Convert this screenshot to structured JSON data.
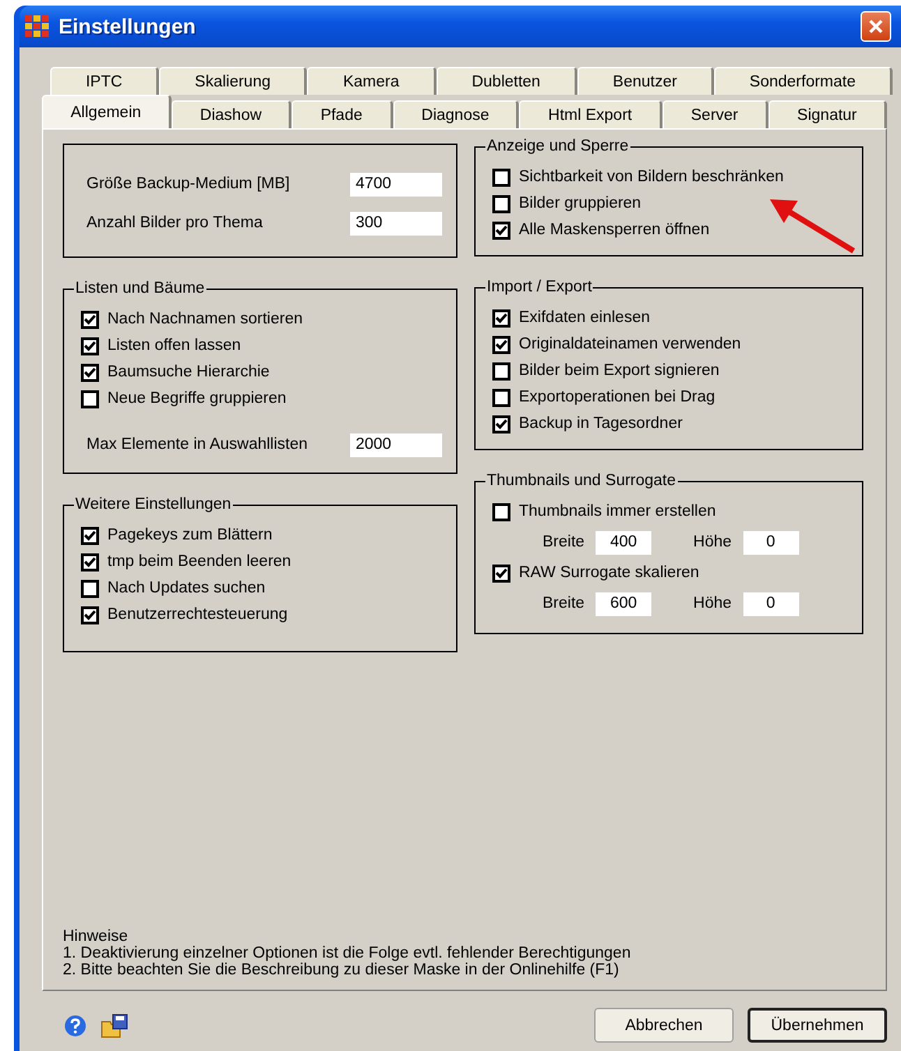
{
  "window": {
    "title": "Einstellungen"
  },
  "tab_rows": [
    [
      {
        "label": "IPTC",
        "selected": false
      },
      {
        "label": "Skalierung",
        "selected": false
      },
      {
        "label": "Kamera",
        "selected": false
      },
      {
        "label": "Dubletten",
        "selected": false
      },
      {
        "label": "Benutzer",
        "selected": false
      },
      {
        "label": "Sonderformate",
        "selected": false
      }
    ],
    [
      {
        "label": "Allgemein",
        "selected": true
      },
      {
        "label": "Diashow",
        "selected": false
      },
      {
        "label": "Pfade",
        "selected": false
      },
      {
        "label": "Diagnose",
        "selected": false
      },
      {
        "label": "Html Export",
        "selected": false
      },
      {
        "label": "Server",
        "selected": false
      },
      {
        "label": "Signatur",
        "selected": false
      }
    ]
  ],
  "left_column": [
    {
      "items": [
        {
          "kind": "field",
          "label": "Größe Backup-Medium [MB]",
          "value": "4700"
        },
        {
          "kind": "field",
          "label": "Anzahl Bilder pro Thema",
          "value": "300"
        }
      ]
    },
    {
      "title": "Listen und Bäume",
      "items": [
        {
          "kind": "checkbox",
          "label": "Nach Nachnamen sortieren",
          "checked": true
        },
        {
          "kind": "checkbox",
          "label": "Listen offen lassen",
          "checked": true
        },
        {
          "kind": "checkbox",
          "label": "Baumsuche Hierarchie",
          "checked": true
        },
        {
          "kind": "checkbox",
          "label": "Neue Begriffe gruppieren",
          "checked": false
        },
        {
          "kind": "field",
          "label": "Max Elemente in Auswahllisten",
          "value": "2000"
        }
      ]
    },
    {
      "title": "Weitere Einstellungen",
      "items": [
        {
          "kind": "checkbox",
          "label": "Pagekeys zum Blättern",
          "checked": true
        },
        {
          "kind": "checkbox",
          "label": "tmp beim Beenden leeren",
          "checked": true
        },
        {
          "kind": "checkbox",
          "label": "Nach Updates suchen",
          "checked": false
        },
        {
          "kind": "checkbox",
          "label": "Benutzerrechtesteuerung",
          "checked": true
        }
      ]
    }
  ],
  "right_column": [
    {
      "title": "Anzeige und Sperre",
      "items": [
        {
          "kind": "checkbox",
          "label": "Sichtbarkeit von Bildern beschränken",
          "checked": false
        },
        {
          "kind": "checkbox",
          "label": "Bilder gruppieren",
          "checked": false
        },
        {
          "kind": "checkbox",
          "label": "Alle Maskensperren öffnen",
          "checked": true
        }
      ]
    },
    {
      "title": "Import / Export",
      "items": [
        {
          "kind": "checkbox",
          "label": "Exifdaten einlesen",
          "checked": true
        },
        {
          "kind": "checkbox",
          "label": "Originaldateinamen verwenden",
          "checked": true
        },
        {
          "kind": "checkbox",
          "label": "Bilder beim Export signieren",
          "checked": false
        },
        {
          "kind": "checkbox",
          "label": "Exportoperationen bei Drag",
          "checked": false
        },
        {
          "kind": "checkbox",
          "label": "Backup in Tagesordner",
          "checked": true
        }
      ]
    },
    {
      "title": "Thumbnails und Surrogate",
      "items": [
        {
          "kind": "checkbox",
          "label": "Thumbnails immer erstellen",
          "checked": false
        },
        {
          "kind": "size_row",
          "fields": [
            {
              "label": "Breite",
              "value": "400"
            },
            {
              "label": "Höhe",
              "value": "0"
            }
          ]
        },
        {
          "kind": "checkbox",
          "label": "RAW Surrogate skalieren",
          "checked": true
        },
        {
          "kind": "size_row",
          "fields": [
            {
              "label": "Breite",
              "value": "600"
            },
            {
              "label": "Höhe",
              "value": "0"
            }
          ]
        }
      ]
    }
  ],
  "notes": {
    "title": "Hinweise",
    "lines": [
      "1. Deaktivierung einzelner Optionen ist die Folge evtl. fehlender Berechtigungen",
      "2. Bitte beachten Sie die Beschreibung zu dieser Maske in der Onlinehilfe (F1)"
    ]
  },
  "buttons": [
    {
      "label": "Abbrechen",
      "default": false
    },
    {
      "label": "Übernehmen",
      "default": true
    }
  ]
}
